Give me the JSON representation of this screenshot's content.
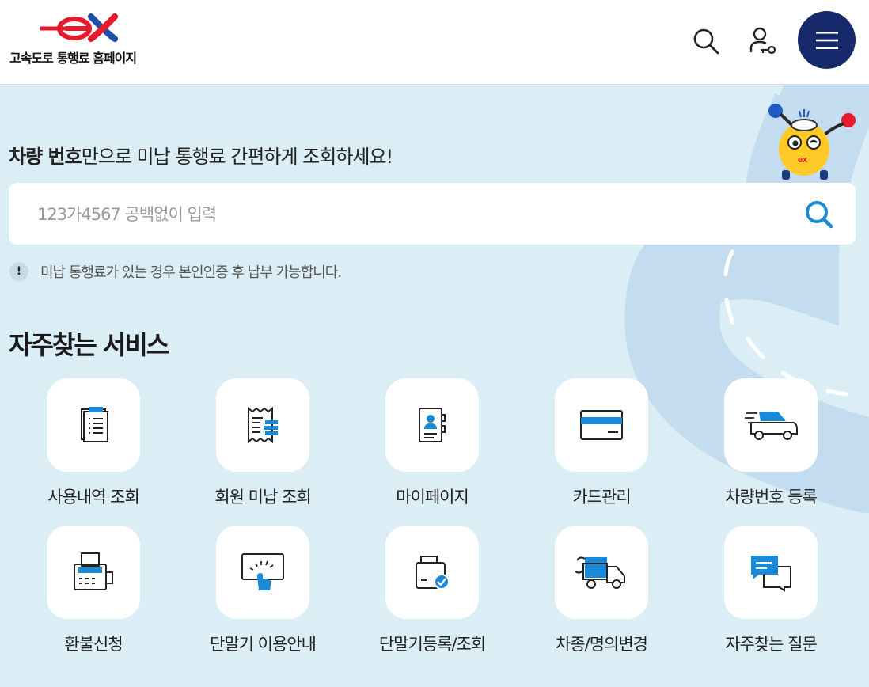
{
  "header": {
    "logo_text": "고속도로 통행료 홈페이지",
    "search_icon": "search-icon",
    "user_icon": "user-key-icon",
    "menu_icon": "hamburger-menu-icon"
  },
  "hero": {
    "headline_bold": "차량 번호",
    "headline_rest": "만으로 미납 통행료 간편하게 조회하세요!",
    "search_placeholder": "123가4567 공백없이 입력",
    "search_value": "",
    "notice_badge": "!",
    "notice_text": "미납 통행료가 있는 경우 본인인증 후 납부 가능합니다."
  },
  "services": {
    "title": "자주찾는 서비스",
    "items": [
      {
        "label": "사용내역 조회",
        "icon": "document-list-icon"
      },
      {
        "label": "회원 미납 조회",
        "icon": "receipt-icon"
      },
      {
        "label": "마이페이지",
        "icon": "profile-book-icon"
      },
      {
        "label": "카드관리",
        "icon": "credit-card-icon"
      },
      {
        "label": "차량번호 등록",
        "icon": "car-icon"
      },
      {
        "label": "환불신청",
        "icon": "fax-machine-icon"
      },
      {
        "label": "단말기 이용안내",
        "icon": "touch-screen-icon"
      },
      {
        "label": "단말기등록/조회",
        "icon": "device-check-icon"
      },
      {
        "label": "차종/명의변경",
        "icon": "truck-swap-icon"
      },
      {
        "label": "자주찾는 질문",
        "icon": "chat-bubbles-icon"
      }
    ]
  },
  "colors": {
    "accent_blue": "#1a8ad8",
    "navy": "#15296b",
    "background": "#dbeef5",
    "brand_red": "#e8192c"
  }
}
